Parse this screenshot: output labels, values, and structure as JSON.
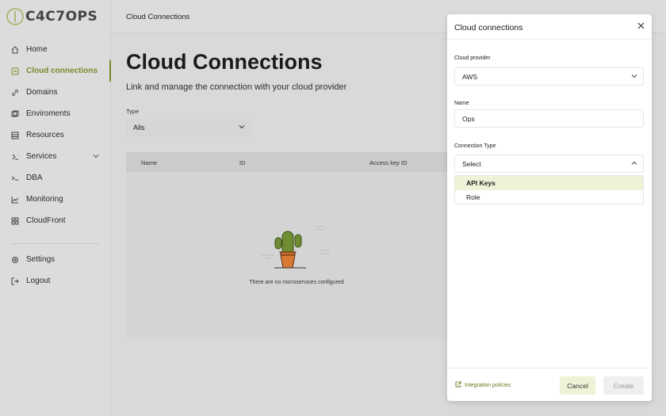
{
  "brand": {
    "logo_text": "C4C7OPS"
  },
  "topbar": {
    "title": "Cloud Connections"
  },
  "sidebar": {
    "items": [
      {
        "label": "Home",
        "icon": "home-icon"
      },
      {
        "label": "Cloud connections",
        "icon": "cloud-icon",
        "active": true
      },
      {
        "label": "Domains",
        "icon": "link-icon"
      },
      {
        "label": "Enviroments",
        "icon": "layers-icon"
      },
      {
        "label": "Resources",
        "icon": "box-icon"
      },
      {
        "label": "Services",
        "icon": "services-icon",
        "expandable": true
      },
      {
        "label": "DBA",
        "icon": "terminal-icon"
      },
      {
        "label": "Monitoring",
        "icon": "chart-icon"
      },
      {
        "label": "CloudFront",
        "icon": "grid-icon"
      }
    ],
    "bottom_items": [
      {
        "label": "Settings",
        "icon": "gear-icon"
      },
      {
        "label": "Logout",
        "icon": "logout-icon"
      }
    ]
  },
  "main": {
    "title": "Cloud Connections",
    "subtitle": "Link and manage the connection with your cloud provider",
    "type_label": "Type",
    "type_value": "Alls",
    "table": {
      "columns": [
        "Name",
        "ID",
        "Access key ID"
      ],
      "empty_text": "There are no microservices configured"
    }
  },
  "modal": {
    "title": "Cloud connections",
    "fields": {
      "provider_label": "Cloud provider",
      "provider_value": "AWS",
      "name_label": "Name",
      "name_value": "Ops",
      "conn_type_label": "Connection Type",
      "conn_type_value": "Select"
    },
    "options": [
      "API Keys",
      "Role"
    ],
    "footer": {
      "link": "Integration policies",
      "cancel": "Cancel",
      "create": "Create"
    }
  },
  "colors": {
    "accent": "#7e8a2b",
    "highlight": "#edf3d6"
  }
}
